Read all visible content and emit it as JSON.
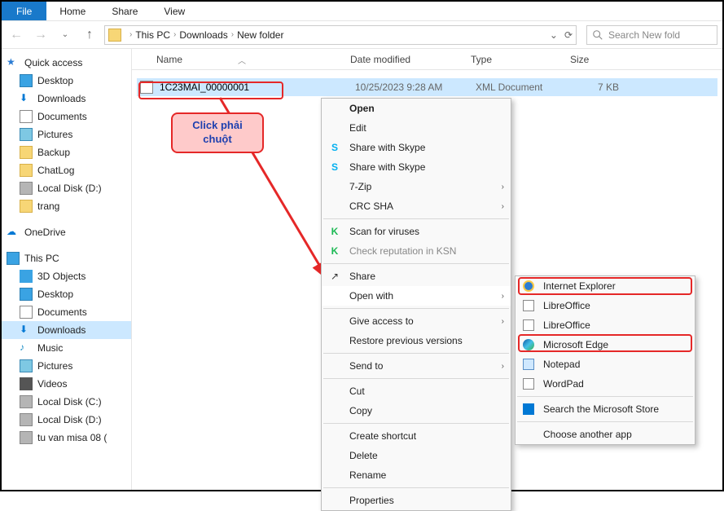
{
  "ribbon": {
    "file": "File",
    "home": "Home",
    "share": "Share",
    "view": "View"
  },
  "breadcrumb": {
    "root": "This PC",
    "p1": "Downloads",
    "p2": "New folder"
  },
  "search": {
    "placeholder": "Search New fold"
  },
  "nav": {
    "quick": "Quick access",
    "desktop": "Desktop",
    "downloads": "Downloads",
    "documents": "Documents",
    "pictures": "Pictures",
    "backup": "Backup",
    "chatlog": "ChatLog",
    "localD": "Local Disk (D:)",
    "trang": "trang",
    "onedrive": "OneDrive",
    "thispc": "This PC",
    "threeD": "3D Objects",
    "desktop2": "Desktop",
    "documents2": "Documents",
    "downloads2": "Downloads",
    "music": "Music",
    "pictures2": "Pictures",
    "videos": "Videos",
    "localC": "Local Disk (C:)",
    "localD2": "Local Disk (D:)",
    "tuvan": "tu van misa 08 ("
  },
  "cols": {
    "name": "Name",
    "date": "Date modified",
    "type": "Type",
    "size": "Size"
  },
  "file": {
    "name": "1C23MAI_00000001",
    "date": "10/25/2023 9:28 AM",
    "type": "XML Document",
    "size": "7 KB"
  },
  "tooltip": "Click phải chuột",
  "ctx": {
    "open": "Open",
    "edit": "Edit",
    "skype1": "Share with Skype",
    "skype2": "Share with Skype",
    "sevenzip": "7-Zip",
    "crc": "CRC SHA",
    "scan": "Scan for viruses",
    "rep": "Check reputation in KSN",
    "share": "Share",
    "openwith": "Open with",
    "giveaccess": "Give access to",
    "restore": "Restore previous versions",
    "sendto": "Send to",
    "cut": "Cut",
    "copy": "Copy",
    "createsc": "Create shortcut",
    "delete": "Delete",
    "rename": "Rename",
    "properties": "Properties"
  },
  "ow": {
    "ie": "Internet Explorer",
    "libre1": "LibreOffice",
    "libre2": "LibreOffice",
    "edge": "Microsoft Edge",
    "notepad": "Notepad",
    "wordpad": "WordPad",
    "store": "Search the Microsoft Store",
    "choose": "Choose another app"
  }
}
